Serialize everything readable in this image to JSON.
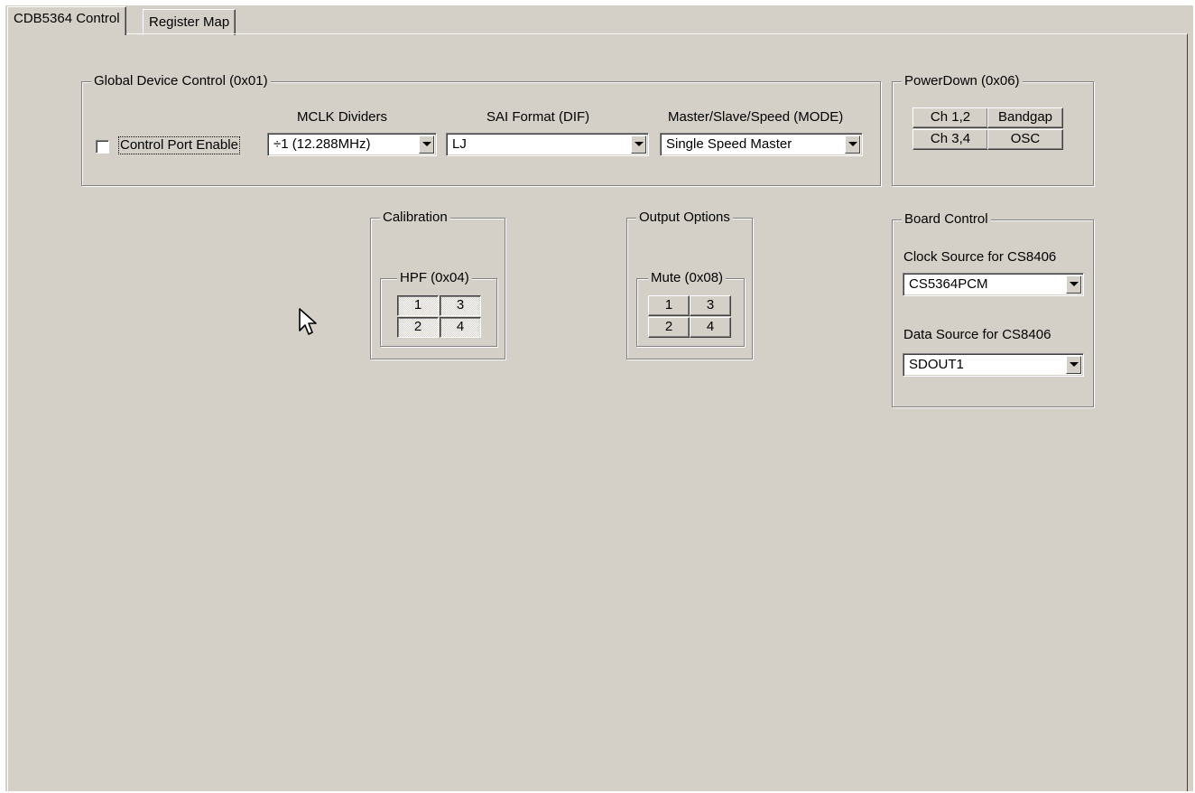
{
  "tabs": [
    {
      "label": "CDB5364 Control",
      "active": true
    },
    {
      "label": "Register Map",
      "active": false
    }
  ],
  "global": {
    "title": "Global Device Control (0x01)",
    "control_port_label": "Control Port Enable",
    "control_port_checked": false,
    "mclk_label": "MCLK Dividers",
    "mclk_value": "÷1    (12.288MHz)",
    "sai_label": "SAI Format (DIF)",
    "sai_value": "LJ",
    "mode_label": "Master/Slave/Speed (MODE)",
    "mode_value": "Single Speed Master"
  },
  "powerdown": {
    "title": "PowerDown (0x06)",
    "buttons": [
      "Ch 1,2",
      "Bandgap",
      "Ch 3,4",
      "OSC"
    ]
  },
  "calibration": {
    "title": "Calibration",
    "hpf_title": "HPF (0x04)",
    "buttons": [
      "1",
      "3",
      "2",
      "4"
    ]
  },
  "output": {
    "title": "Output Options",
    "mute_title": "Mute (0x08)",
    "buttons": [
      "1",
      "3",
      "2",
      "4"
    ]
  },
  "board": {
    "title": "Board Control",
    "clock_label": "Clock Source for CS8406",
    "clock_value": "CS5364PCM",
    "data_label": "Data Source for CS8406",
    "data_value": "SDOUT1"
  },
  "colors": {
    "face": "#d4d0c8",
    "shadow": "#808080",
    "highlight": "#ffffff"
  },
  "icons": {
    "cursor": "arrow-cursor-icon",
    "dropdown": "chevron-down-icon"
  }
}
